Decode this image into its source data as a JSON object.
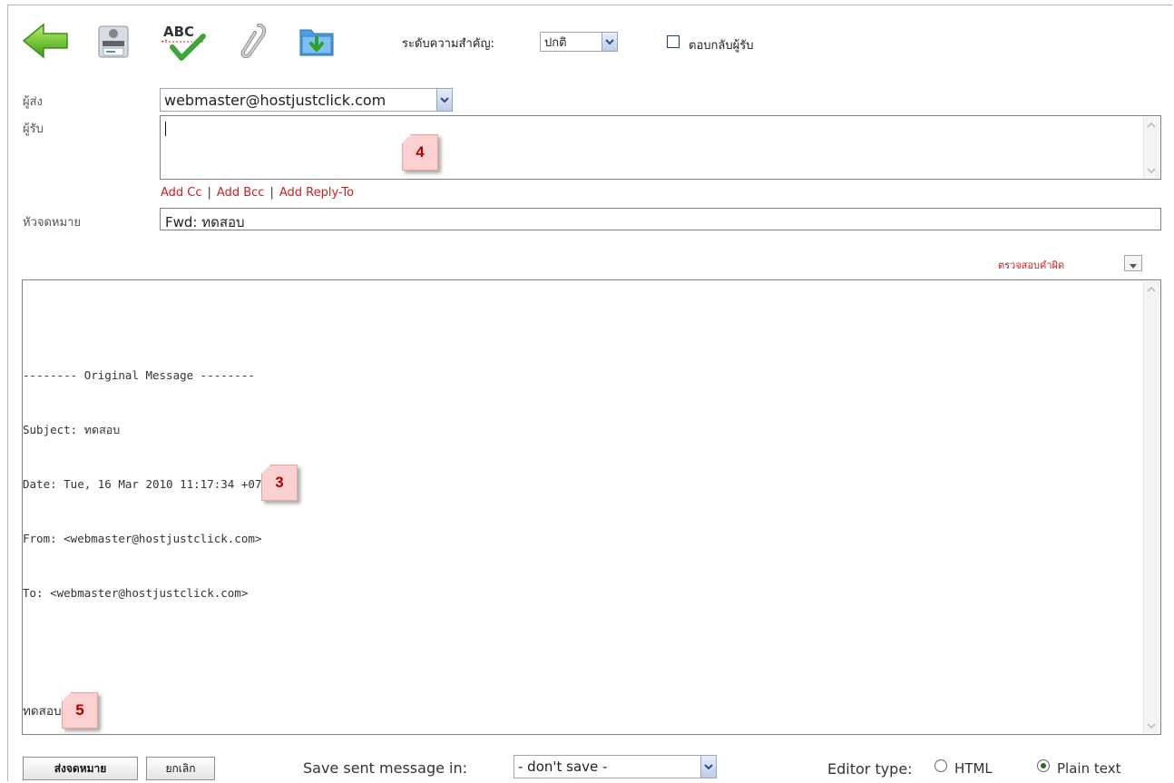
{
  "toolbar": {
    "icons": [
      "back-arrow-icon",
      "print-icon",
      "spellcheck-icon",
      "attachment-icon",
      "save-draft-icon"
    ],
    "spell_icon_text": "ABC",
    "priority_label": "ระดับความสำคัญ:",
    "priority_value": "ปกติ",
    "receipt_label": "ตอบกลับผู้รับ"
  },
  "form": {
    "from_label": "ผู้ส่ง",
    "from_value": "webmaster@hostjustclick.com",
    "to_label": "ผู้รับ",
    "to_value": "",
    "add_cc": "Add Cc",
    "add_bcc": "Add Bcc",
    "add_reply_to": "Add Reply-To",
    "separator": "|",
    "subject_label": "หัวจดหมาย",
    "subject_value": "Fwd: ทดสอบ"
  },
  "spellcheck_label": "ตรวจสอบคำผิด",
  "body": {
    "lines": [
      "-------- Original Message --------",
      "Subject: ทดสอบ",
      "Date: Tue, 16 Mar 2010 11:17:34 +0700",
      "From: <webmaster@hostjustclick.com>",
      "To: <webmaster@hostjustclick.com>",
      "",
      "ทดสอบ"
    ]
  },
  "annotations": {
    "to_note": "4",
    "body_note": "3",
    "footer_note": "5"
  },
  "footer": {
    "send_label": "ส่งจดหมาย",
    "cancel_label": "ยกเลิก",
    "save_in_label": "Save sent message in:",
    "save_in_value": "- don't save -",
    "editor_type_label": "Editor type:",
    "editor_html": "HTML",
    "editor_plain": "Plain text",
    "editor_selected": "Plain text"
  },
  "colors": {
    "link": "#cc1f1f",
    "note_bg": "#fbd0d0",
    "note_text": "#b00000"
  }
}
